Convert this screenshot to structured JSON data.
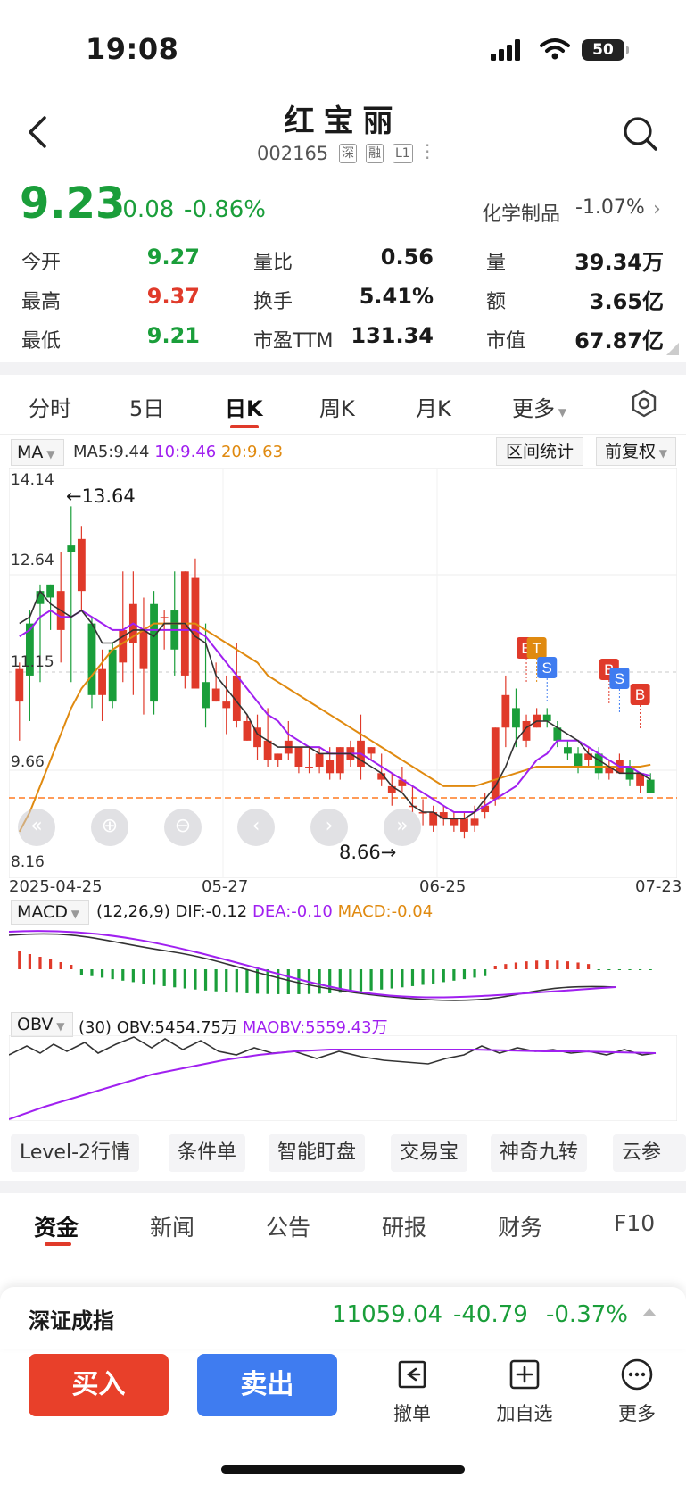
{
  "status_bar": {
    "time": "19:08",
    "battery": "50"
  },
  "header": {
    "title": "红宝丽",
    "code": "002165",
    "tags": [
      "深",
      "融",
      "L1"
    ]
  },
  "quote": {
    "price": "9.23",
    "change": "-0.08",
    "change_pct": "-0.86%",
    "sector": "化学制品",
    "sector_change": "-1.07%",
    "stats": [
      {
        "label": "今开",
        "value": "9.27",
        "color": "green"
      },
      {
        "label": "量比",
        "value": "0.56",
        "color": "black"
      },
      {
        "label": "量",
        "value": "39.34万",
        "color": "black"
      },
      {
        "label": "最高",
        "value": "9.37",
        "color": "red"
      },
      {
        "label": "换手",
        "value": "5.41%",
        "color": "black"
      },
      {
        "label": "额",
        "value": "3.65亿",
        "color": "black"
      },
      {
        "label": "最低",
        "value": "9.21",
        "color": "green"
      },
      {
        "label": "市盈TTM",
        "value": "131.34",
        "color": "black"
      },
      {
        "label": "市值",
        "value": "67.87亿",
        "color": "black"
      }
    ]
  },
  "period_tabs": [
    "分时",
    "5日",
    "日K",
    "周K",
    "月K",
    "更多"
  ],
  "active_period": "日K",
  "chart_toolbar": {
    "ma_label": "MA",
    "ma5": "MA5:9.44",
    "ma10": "10:9.46",
    "ma20": "20:9.63",
    "range_stats": "区间统计",
    "adjust": "前复权"
  },
  "chart_labels": {
    "y_ticks": [
      "14.14",
      "12.64",
      "11.15",
      "9.66",
      "8.16"
    ],
    "high_mark": "←13.64",
    "low_mark": "8.66→",
    "dates": [
      "2025-04-25",
      "05-27",
      "06-25",
      "07-23"
    ]
  },
  "macd": {
    "label": "MACD",
    "params": "(12,26,9)",
    "dif": "DIF:-0.12",
    "dea": "DEA:-0.10",
    "macd": "MACD:-0.04"
  },
  "obv": {
    "label": "OBV",
    "params": "(30)",
    "obv": "OBV:5454.75万",
    "maobv": "MAOBV:5559.43万"
  },
  "colors": {
    "up": "#e03a2a",
    "down": "#1a9e3a",
    "ma5": "#333333",
    "ma10": "#a020f0",
    "ma20": "#e08a10",
    "sell_blue": "#3f7cf0"
  },
  "feature_chips": [
    "Level-2行情",
    "条件单",
    "智能盯盘",
    "交易宝",
    "神奇九转",
    "云参"
  ],
  "news_tabs": [
    "资金",
    "新闻",
    "公告",
    "研报",
    "财务",
    "F10"
  ],
  "index_bar": {
    "name": "深证成指",
    "value": "11059.04",
    "change": "-40.79",
    "change_pct": "-0.37%"
  },
  "actions": {
    "buy": "买入",
    "sell": "卖出",
    "cancel": "撤单",
    "watchlist": "加自选",
    "more": "更多"
  },
  "chart_data": {
    "type": "candlestick",
    "y_range": [
      8.16,
      14.14
    ],
    "marked_high": 13.64,
    "marked_low": 8.66,
    "candles": [
      [
        10.6,
        11.1,
        10.0,
        11.2
      ],
      [
        11.8,
        11.0,
        10.3,
        12.0
      ],
      [
        12.3,
        12.1,
        10.9,
        12.4
      ],
      [
        12.4,
        12.2,
        11.7,
        12.4
      ],
      [
        11.7,
        12.3,
        11.2,
        12.9
      ],
      [
        13.0,
        12.9,
        10.9,
        13.6
      ],
      [
        12.3,
        13.1,
        12.0,
        13.3
      ],
      [
        11.8,
        10.7,
        10.5,
        11.9
      ],
      [
        10.7,
        11.1,
        10.3,
        11.4
      ],
      [
        11.4,
        10.6,
        10.5,
        11.5
      ],
      [
        11.2,
        11.7,
        10.9,
        12.6
      ],
      [
        11.5,
        12.1,
        10.7,
        12.6
      ],
      [
        11.1,
        11.7,
        10.4,
        12.2
      ],
      [
        12.1,
        10.6,
        10.4,
        12.3
      ],
      [
        11.9,
        11.9,
        11.4,
        12.0
      ],
      [
        12.0,
        11.4,
        11.0,
        12.6
      ],
      [
        11.0,
        12.6,
        10.8,
        12.6
      ],
      [
        10.8,
        12.5,
        10.8,
        12.8
      ],
      [
        10.9,
        10.5,
        10.2,
        11.8
      ],
      [
        10.6,
        10.8,
        10.6,
        11.2
      ],
      [
        10.5,
        10.6,
        10.1,
        11.0
      ],
      [
        10.3,
        11.0,
        10.2,
        11.5
      ],
      [
        10.0,
        10.3,
        10.0,
        10.4
      ],
      [
        9.9,
        10.2,
        9.7,
        10.4
      ],
      [
        9.7,
        10.0,
        9.6,
        10.5
      ],
      [
        9.7,
        9.8,
        9.6,
        9.8
      ],
      [
        9.8,
        10.0,
        9.7,
        10.3
      ],
      [
        9.6,
        9.9,
        9.5,
        9.9
      ],
      [
        9.6,
        9.6,
        9.5,
        9.9
      ],
      [
        9.6,
        9.8,
        9.5,
        9.9
      ],
      [
        9.5,
        9.7,
        9.4,
        9.9
      ],
      [
        9.5,
        9.9,
        9.4,
        9.9
      ],
      [
        9.7,
        9.9,
        9.6,
        10.0
      ],
      [
        9.6,
        10.0,
        9.4,
        10.4
      ],
      [
        9.8,
        9.9,
        9.7,
        9.9
      ],
      [
        9.4,
        9.5,
        9.3,
        9.8
      ],
      [
        9.2,
        9.3,
        9.0,
        9.5
      ],
      [
        9.3,
        9.4,
        9.2,
        9.6
      ],
      [
        9.0,
        9.0,
        8.9,
        9.3
      ],
      [
        8.9,
        8.9,
        8.7,
        9.1
      ],
      [
        8.7,
        8.9,
        8.6,
        9.0
      ],
      [
        8.8,
        8.9,
        8.7,
        9.0
      ],
      [
        8.7,
        8.8,
        8.6,
        8.9
      ],
      [
        8.6,
        8.8,
        8.5,
        8.9
      ],
      [
        8.7,
        8.8,
        8.6,
        9.0
      ],
      [
        8.9,
        9.0,
        8.8,
        9.2
      ],
      [
        9.1,
        10.2,
        9.0,
        10.2
      ],
      [
        10.2,
        10.7,
        9.9,
        11.0
      ],
      [
        10.5,
        10.2,
        9.9,
        10.8
      ],
      [
        10.0,
        10.3,
        9.9,
        10.4
      ],
      [
        10.2,
        10.4,
        10.2,
        10.5
      ],
      [
        10.4,
        10.3,
        10.2,
        10.5
      ],
      [
        10.2,
        10.0,
        9.9,
        10.3
      ],
      [
        9.9,
        9.8,
        9.7,
        10.0
      ],
      [
        9.8,
        9.6,
        9.5,
        9.9
      ],
      [
        9.7,
        9.8,
        9.6,
        9.9
      ],
      [
        9.8,
        9.5,
        9.4,
        9.9
      ],
      [
        9.5,
        9.6,
        9.4,
        9.7
      ],
      [
        9.5,
        9.7,
        9.5,
        9.8
      ],
      [
        9.6,
        9.4,
        9.3,
        9.7
      ],
      [
        9.3,
        9.5,
        9.2,
        9.5
      ],
      [
        9.4,
        9.2,
        9.2,
        9.5
      ]
    ],
    "ma5": [
      11.8,
      11.9,
      12.3,
      12.1,
      12.0,
      11.9,
      12.0,
      11.8,
      11.5,
      11.5,
      11.6,
      11.7,
      11.7,
      11.6,
      11.8,
      11.8,
      11.8,
      11.6,
      11.5,
      11.0,
      10.8,
      10.6,
      10.4,
      10.1,
      10.0,
      9.9,
      9.9,
      9.9,
      9.9,
      9.8,
      9.8,
      9.8,
      9.8,
      9.7,
      9.6,
      9.5,
      9.3,
      9.2,
      9.0,
      8.9,
      8.9,
      8.8,
      8.8,
      8.8,
      8.9,
      9.1,
      9.3,
      9.6,
      10.0,
      10.2,
      10.3,
      10.3,
      10.2,
      10.1,
      10.0,
      9.8,
      9.7,
      9.6,
      9.5,
      9.5,
      9.5,
      9.4
    ],
    "ma10": [
      11.6,
      11.7,
      11.9,
      12.0,
      11.9,
      11.9,
      12.0,
      11.9,
      11.8,
      11.7,
      11.7,
      11.8,
      11.7,
      11.7,
      11.7,
      11.7,
      11.7,
      11.7,
      11.6,
      11.4,
      11.2,
      11.0,
      10.8,
      10.6,
      10.4,
      10.3,
      10.1,
      10.0,
      9.9,
      9.9,
      9.8,
      9.8,
      9.8,
      9.8,
      9.7,
      9.6,
      9.5,
      9.4,
      9.3,
      9.2,
      9.1,
      9.0,
      8.9,
      8.9,
      8.9,
      9.0,
      9.1,
      9.2,
      9.3,
      9.5,
      9.7,
      9.8,
      10.0,
      10.0,
      10.0,
      9.9,
      9.8,
      9.7,
      9.6,
      9.6,
      9.5,
      9.46
    ],
    "ma20": [
      8.6,
      8.9,
      9.3,
      9.7,
      10.1,
      10.5,
      10.8,
      11.0,
      11.2,
      11.4,
      11.5,
      11.6,
      11.7,
      11.8,
      11.8,
      11.8,
      11.8,
      11.8,
      11.7,
      11.6,
      11.5,
      11.4,
      11.3,
      11.2,
      11.0,
      10.9,
      10.8,
      10.7,
      10.6,
      10.5,
      10.4,
      10.3,
      10.2,
      10.1,
      10.0,
      9.9,
      9.8,
      9.7,
      9.6,
      9.5,
      9.4,
      9.3,
      9.3,
      9.3,
      9.3,
      9.35,
      9.4,
      9.45,
      9.5,
      9.55,
      9.6,
      9.6,
      9.6,
      9.6,
      9.6,
      9.6,
      9.6,
      9.6,
      9.6,
      9.6,
      9.6,
      9.63
    ],
    "signals": [
      "B",
      "T",
      "S",
      "B",
      "S",
      "B"
    ]
  }
}
